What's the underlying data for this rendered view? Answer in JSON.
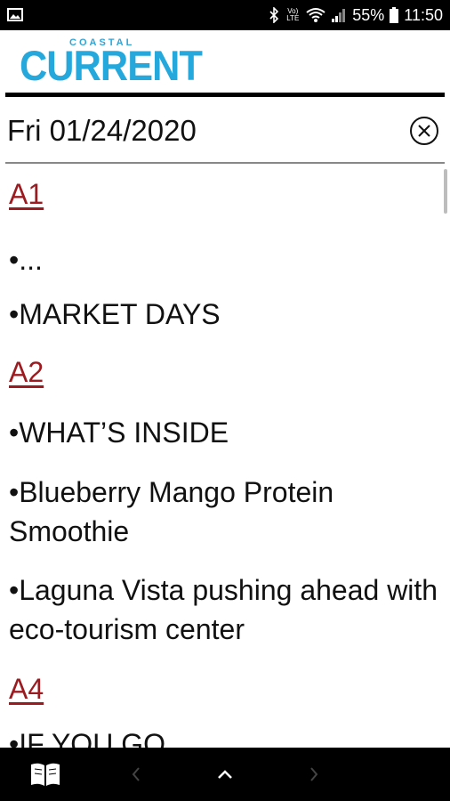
{
  "status_bar": {
    "battery": "55%",
    "time": "11:50",
    "volte_label": "Vo) LTE"
  },
  "header": {
    "logo_small": "COASTAL",
    "logo_big": "CURRENT"
  },
  "date_bar": {
    "date": "Fri 01/24/2020"
  },
  "content": {
    "sections": [
      {
        "label": "A1",
        "items": [
          "•...",
          "•MARKET DAYS"
        ]
      },
      {
        "label": "A2",
        "items": [
          "•WHAT’S INSIDE",
          "•Blueberry Mango Protein Smoothie",
          "•Laguna Vista pushing ahead with eco-tourism center"
        ]
      },
      {
        "label": "A4",
        "items": [
          "•IF YOU GO"
        ]
      }
    ]
  },
  "colors": {
    "logo": "#25a9dc",
    "section_link": "#9b1b20",
    "bars": "#000000"
  },
  "icons": {
    "clear": "circle-x-icon",
    "library": "open-book-icon",
    "prev": "chevron-left-icon",
    "up": "chevron-up-icon",
    "next": "chevron-right-icon"
  }
}
